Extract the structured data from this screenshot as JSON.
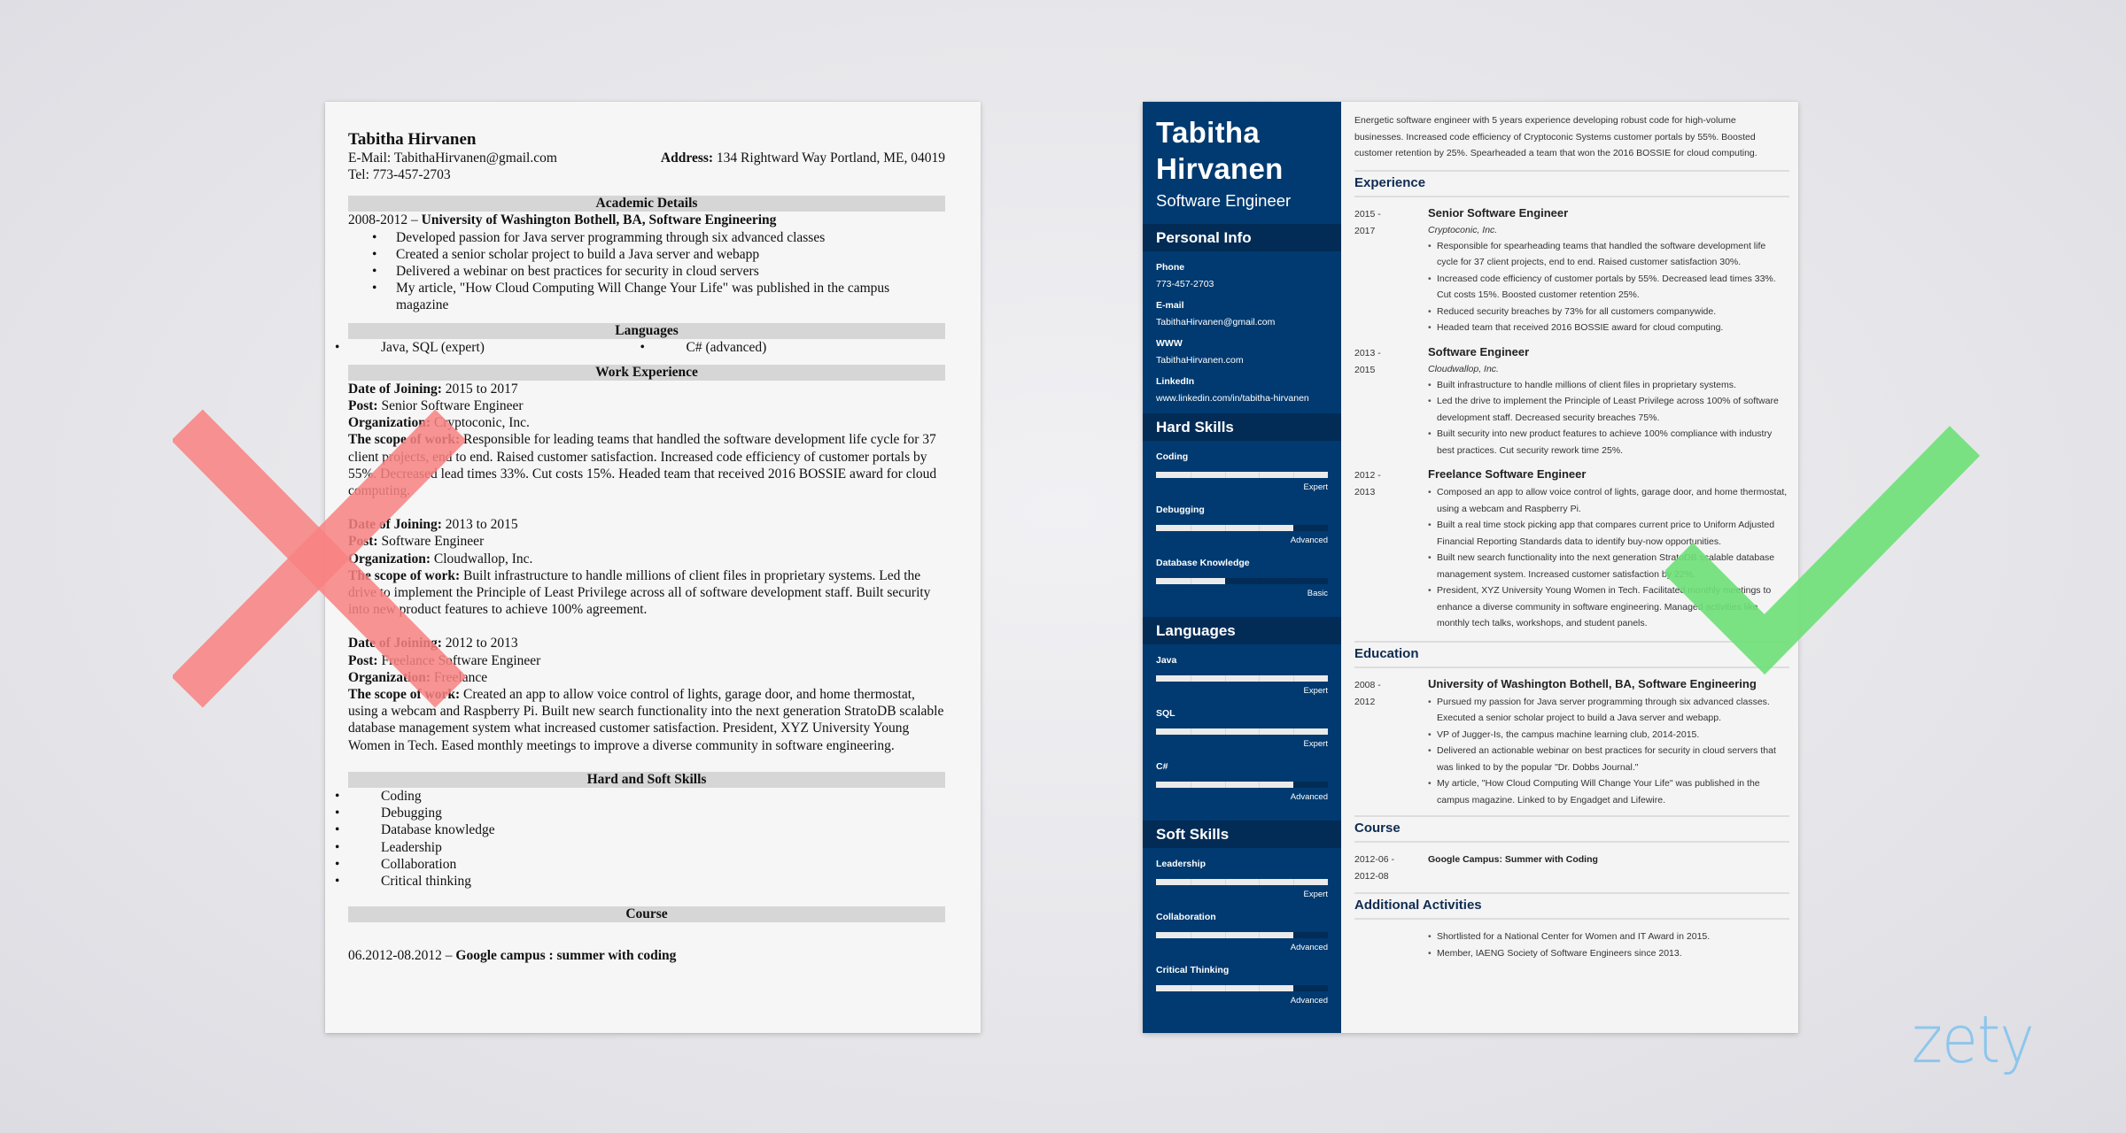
{
  "bad_resume": {
    "name": "Tabitha Hirvanen",
    "email_label": "E-Mail:",
    "email": "TabithaHirvanen@gmail.com",
    "address_label": "Address:",
    "address": "134 Rightward Way Portland, ME, 04019",
    "tel_label": "Tel:",
    "tel": "773-457-2703",
    "sections": {
      "academic": "Academic Details",
      "languages": "Languages",
      "work": "Work Experience",
      "skills": "Hard and Soft Skills",
      "course": "Course"
    },
    "academic": {
      "dates": "2008-2012 – ",
      "school": "University of Washington Bothell, BA, Software Engineering",
      "bullets": [
        "Developed passion for Java server programming through six advanced classes",
        "Created a senior scholar project to build a Java server and webapp",
        "Delivered a webinar on best practices for security in cloud servers",
        "My article, \"How Cloud Computing Will Change Your Life\" was published in the campus magazine"
      ]
    },
    "languages": [
      "Java, SQL (expert)",
      "C# (advanced)"
    ],
    "labels": {
      "date": "Date of Joining:",
      "post": "Post:",
      "org": "Organization:",
      "scope": "The scope of work:"
    },
    "jobs": [
      {
        "date": "2015 to 2017",
        "post": "Senior Software Engineer",
        "org": "Cryptoconic, Inc.",
        "scope": "Responsible for leading teams that handled the software development life cycle for 37 client projects, end to end. Raised customer satisfaction. Increased code efficiency of customer portals by 55%. Decreased lead times 33%. Cut costs 15%. Headed team that received 2016 BOSSIE award for cloud computing."
      },
      {
        "date": "2013 to 2015",
        "post": "Software Engineer",
        "org": "Cloudwallop, Inc.",
        "scope": "Built infrastructure to handle millions of client files in proprietary systems. Led the drive to implement the Principle of Least Privilege across all of software development staff. Built security into new product features to achieve 100% agreement."
      },
      {
        "date": "2012 to 2013",
        "post": "Freelance Software Engineer",
        "org": "Freelance",
        "scope": "Created an app to allow voice control of lights, garage door, and home thermostat, using a webcam and Raspberry Pi. Built new search functionality into the next generation StratoDB scalable database management system what increased customer satisfaction. President, XYZ University Young Women in Tech. Eased monthly meetings to improve a diverse community in software engineering."
      }
    ],
    "skills": [
      "Coding",
      "Debugging",
      "Database knowledge",
      "Leadership",
      "Collaboration",
      "Critical thinking"
    ],
    "course": {
      "dates": "06.2012-08.2012 – ",
      "name": "Google campus : summer with coding"
    }
  },
  "good_resume": {
    "first_name": "Tabitha",
    "last_name": "Hirvanen",
    "role": "Software Engineer",
    "sidebar_sections": {
      "personal": "Personal Info",
      "hard": "Hard Skills",
      "languages": "Languages",
      "soft": "Soft Skills"
    },
    "personal_info": [
      {
        "label": "Phone",
        "value": "773-457-2703"
      },
      {
        "label": "E-mail",
        "value": "TabithaHirvanen@gmail.com"
      },
      {
        "label": "WWW",
        "value": "TabithaHirvanen.com"
      },
      {
        "label": "LinkedIn",
        "value": "www.linkedin.com/in/tabitha-hirvanen"
      }
    ],
    "hard_skills": [
      {
        "name": "Coding",
        "level": "Expert",
        "fraction": 1.0
      },
      {
        "name": "Debugging",
        "level": "Advanced",
        "fraction": 0.8
      },
      {
        "name": "Database Knowledge",
        "level": "Basic",
        "fraction": 0.4
      }
    ],
    "languages": [
      {
        "name": "Java",
        "level": "Expert",
        "fraction": 1.0
      },
      {
        "name": "SQL",
        "level": "Expert",
        "fraction": 1.0
      },
      {
        "name": "C#",
        "level": "Advanced",
        "fraction": 0.8
      }
    ],
    "soft_skills": [
      {
        "name": "Leadership",
        "level": "Expert",
        "fraction": 1.0
      },
      {
        "name": "Collaboration",
        "level": "Advanced",
        "fraction": 0.8
      },
      {
        "name": "Critical Thinking",
        "level": "Advanced",
        "fraction": 0.8
      }
    ],
    "summary": "Energetic software engineer with 5 years experience developing robust code for high-volume businesses. Increased code efficiency of Cryptoconic Systems customer portals by 55%. Boosted customer retention by 25%. Spearheaded a team that won the 2016 BOSSIE for cloud computing.",
    "main_sections": {
      "experience": "Experience",
      "education": "Education",
      "course": "Course",
      "activities": "Additional Activities"
    },
    "experience": [
      {
        "start": "2015 -",
        "end": "2017",
        "title": "Senior Software Engineer",
        "org": "Cryptoconic, Inc.",
        "bullets": [
          "Responsible for spearheading teams that handled the software development life cycle for 37 client projects, end to end. Raised customer satisfaction 30%.",
          "Increased code efficiency of customer portals by 55%. Decreased lead times 33%. Cut costs 15%. Boosted customer retention 25%.",
          "Reduced security breaches by 73% for all customers companywide.",
          "Headed team that received 2016 BOSSIE award for cloud computing."
        ]
      },
      {
        "start": "2013 -",
        "end": "2015",
        "title": "Software Engineer",
        "org": "Cloudwallop, Inc.",
        "bullets": [
          "Built infrastructure to handle millions of client files in proprietary systems.",
          "Led the drive to implement the Principle of Least Privilege across 100% of software development staff. Decreased security breaches 75%.",
          "Built security into new product features to achieve 100% compliance with industry best practices. Cut security rework time 25%."
        ]
      },
      {
        "start": "2012 -",
        "end": "2013",
        "title": "Freelance Software Engineer",
        "org": "",
        "bullets": [
          "Composed an app to allow voice control of lights, garage door, and home thermostat, using a webcam and Raspberry Pi.",
          "Built a real time stock picking app that compares current price to Uniform Adjusted Financial Reporting Standards data to identify buy-now opportunities.",
          "Built new search functionality into the next generation StratoDB scalable database management system. Increased customer satisfaction by 22%.",
          "President, XYZ University Young Women in Tech. Facilitated monthly meetings to enhance a diverse community in software engineering. Managed activities like monthly tech talks, workshops, and student panels."
        ]
      }
    ],
    "education": {
      "start": "2008 -",
      "end": "2012",
      "title": "University of Washington Bothell, BA, Software Engineering",
      "bullets": [
        "Pursued my passion for Java server programming through six advanced classes. Executed a senior scholar project to build a Java server and webapp.",
        "VP of Jugger-Is, the campus machine learning club, 2014-2015.",
        "Delivered an actionable webinar on best practices for security in cloud servers that was linked to by the popular \"Dr. Dobbs Journal.\"",
        "My article, \"How Cloud Computing Will Change Your Life\" was published in the campus magazine. Linked to by Engadget and Lifewire."
      ]
    },
    "course": {
      "start": "2012-06 -",
      "end": "2012-08",
      "title": "Google Campus: Summer with Coding"
    },
    "activities": [
      "Shortlisted for a National Center for Women and IT Award in 2015.",
      "Member, IAENG Society of Software Engineers since 2013."
    ]
  },
  "marks": {
    "bad_icon": "x-mark-icon",
    "good_icon": "check-mark-icon",
    "bad_color": "#f98282",
    "good_color": "#6ee078"
  },
  "brand": {
    "logo_text": "zety",
    "logo_color": "#8dc6ec",
    "sidebar_color": "#003a70"
  }
}
